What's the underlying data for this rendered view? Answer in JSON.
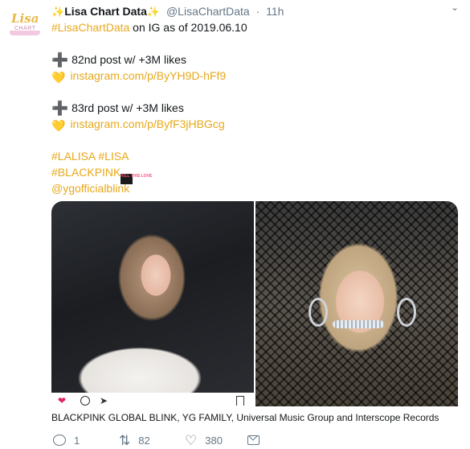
{
  "profile": {
    "avatar_text": "Lisa",
    "avatar_subtext": "CHART DATA",
    "display_name": "Lisa Chart Data",
    "sparkle": "✨",
    "handle": "@LisaChartData",
    "separator": "·",
    "timestamp": "11h",
    "menu_icon": "chevron-down-icon"
  },
  "tweet": {
    "line1_hashtag": "#LisaChartData",
    "line1_rest": " on IG as of 2019.06.10",
    "post1_plus": "➕",
    "post1_text": "82nd post w/ +3M likes",
    "post1_heart": "💛",
    "post1_link": "instagram.com/p/ByYH9D-hFf9",
    "post2_plus": "➕",
    "post2_text": "83rd post w/ +3M likes",
    "post2_heart": "💛",
    "post2_link": "instagram.com/p/ByfF3jHBGcg",
    "hashtags1": "#LALISA #LISA",
    "hashtags2": "#BLACKPINK",
    "kill_this_love_emoji": "KILL THIS LOVE",
    "mention": "@ygofficialblink"
  },
  "media": {
    "left_photo": "photo-blonde-woman-white-shirt",
    "right_photo": "photo-blonde-woman-hoop-earrings",
    "tagged_users": "BLACKPINK GLOBAL BLINK, YG FAMILY, Universal Music Group and Interscope Records"
  },
  "actions": {
    "reply_count": "1",
    "retweet_count": "82",
    "like_count": "380",
    "reply_icon": "reply-icon",
    "retweet_icon": "retweet-icon",
    "like_icon": "heart-icon",
    "dm_icon": "envelope-icon"
  },
  "colors": {
    "link": "#e8a81a",
    "like_red": "#e0245e",
    "meta_gray": "#657786",
    "text": "#14171a"
  }
}
